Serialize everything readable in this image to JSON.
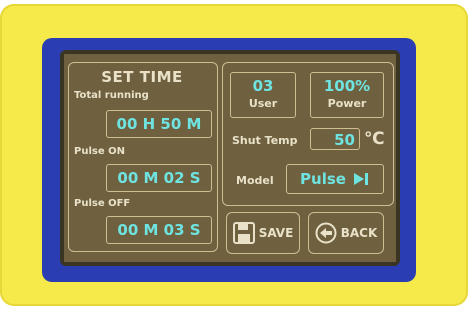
{
  "left_panel": {
    "title": "SET TIME",
    "total_running": {
      "label": "Total running",
      "value": "00 H 50 M"
    },
    "pulse_on": {
      "label": "Pulse ON",
      "value": "00 M 02 S"
    },
    "pulse_off": {
      "label": "Pulse OFF",
      "value": "00 M 03 S"
    }
  },
  "right_panel": {
    "user": {
      "value": "03",
      "label": "User"
    },
    "power": {
      "value": "100%",
      "label": "Power"
    },
    "shut_temp": {
      "label": "Shut Temp",
      "value": "50",
      "unit": "℃"
    },
    "model": {
      "label": "Model",
      "value": "Pulse"
    }
  },
  "buttons": {
    "save": "SAVE",
    "back": "BACK"
  },
  "icons": [
    "floppy-disk-icon",
    "back-arrow-icon",
    "play-next-icon"
  ],
  "colors": {
    "housing": "#f6ea4a",
    "bezel": "#2a3db3",
    "lcd": "#6f6040",
    "value_text": "#6fe3e0",
    "label_text": "#e9e2c8"
  }
}
